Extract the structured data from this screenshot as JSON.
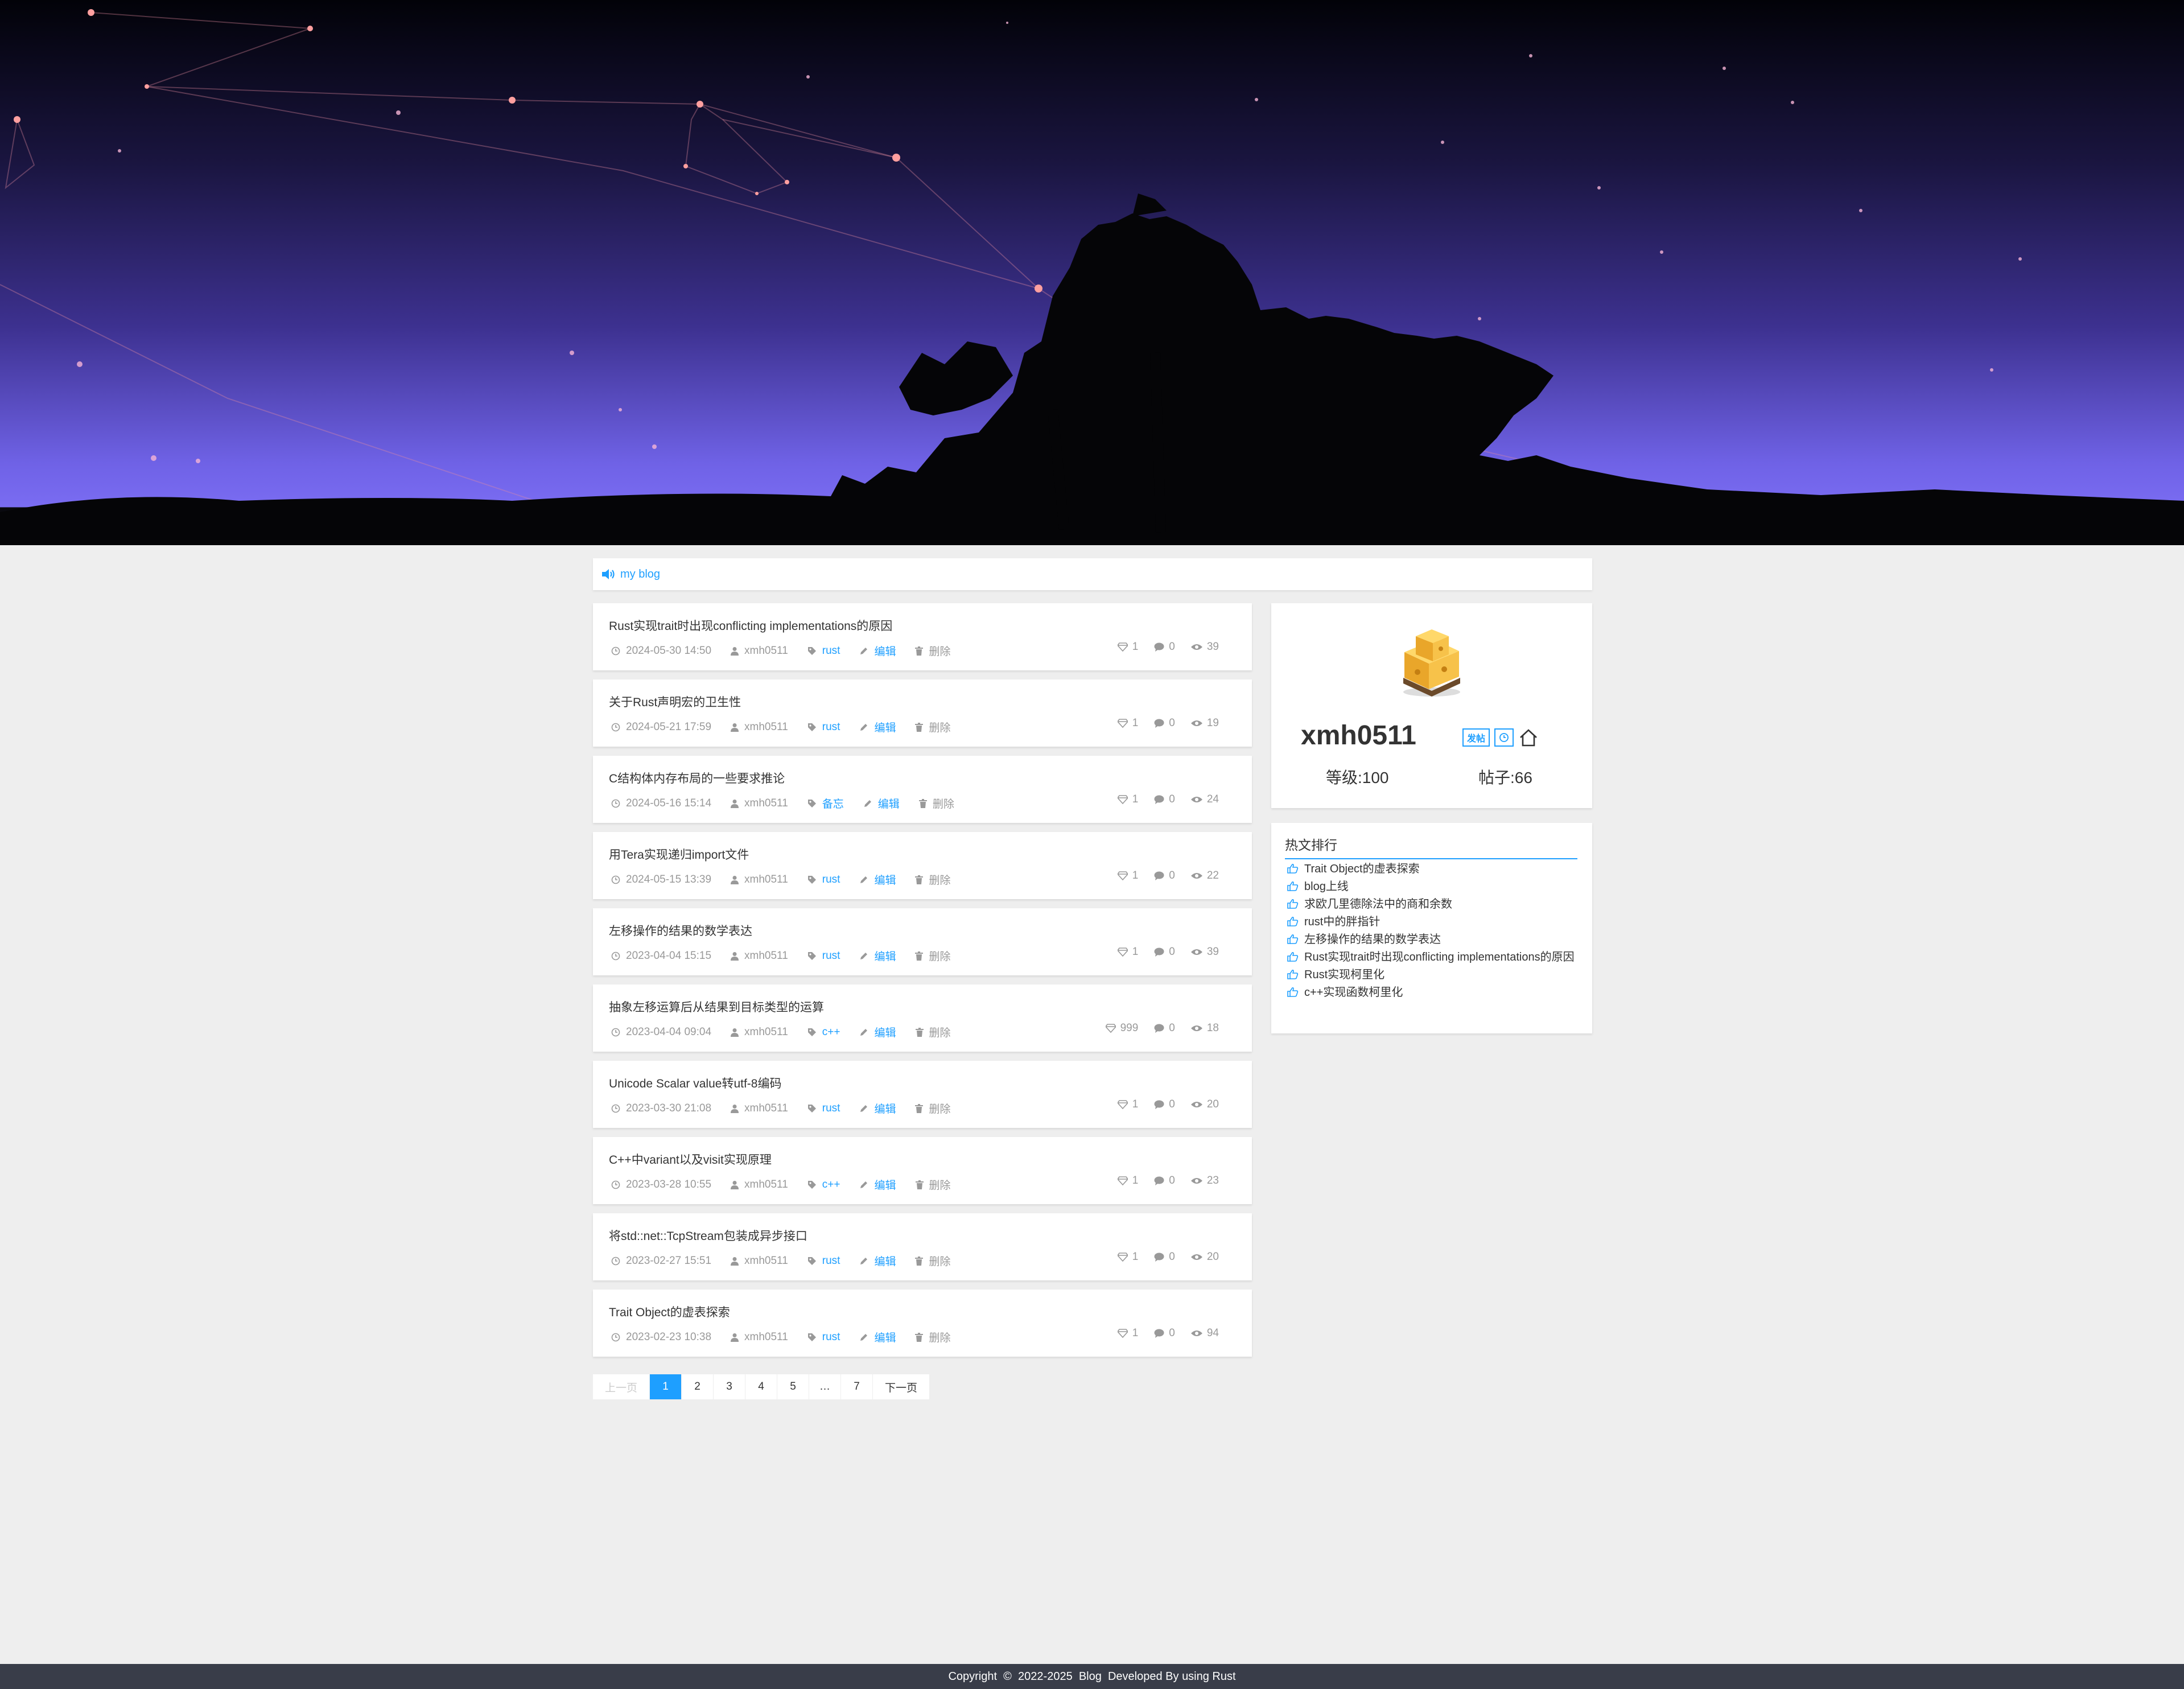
{
  "notice": {
    "label": "my blog"
  },
  "posts": [
    {
      "title": "Rust实现trait时出现conflicting implementations的原因",
      "date": "2024-05-30 14:50",
      "author": "xmh0511",
      "tag": "rust",
      "edit": "编辑",
      "delete": "删除",
      "likes": "1",
      "comments": "0",
      "views": "39"
    },
    {
      "title": "关于Rust声明宏的卫生性",
      "date": "2024-05-21 17:59",
      "author": "xmh0511",
      "tag": "rust",
      "edit": "编辑",
      "delete": "删除",
      "likes": "1",
      "comments": "0",
      "views": "19"
    },
    {
      "title": "C结构体内存布局的一些要求推论",
      "date": "2024-05-16 15:14",
      "author": "xmh0511",
      "tag": "备忘",
      "edit": "编辑",
      "delete": "删除",
      "likes": "1",
      "comments": "0",
      "views": "24"
    },
    {
      "title": "用Tera实现递归import文件",
      "date": "2024-05-15 13:39",
      "author": "xmh0511",
      "tag": "rust",
      "edit": "编辑",
      "delete": "删除",
      "likes": "1",
      "comments": "0",
      "views": "22"
    },
    {
      "title": "左移操作的结果的数学表达",
      "date": "2023-04-04 15:15",
      "author": "xmh0511",
      "tag": "rust",
      "edit": "编辑",
      "delete": "删除",
      "likes": "1",
      "comments": "0",
      "views": "39"
    },
    {
      "title": "抽象左移运算后从结果到目标类型的运算",
      "date": "2023-04-04 09:04",
      "author": "xmh0511",
      "tag": "c++",
      "edit": "编辑",
      "delete": "删除",
      "likes": "999",
      "comments": "0",
      "views": "18"
    },
    {
      "title": "Unicode Scalar value转utf-8编码",
      "date": "2023-03-30 21:08",
      "author": "xmh0511",
      "tag": "rust",
      "edit": "编辑",
      "delete": "删除",
      "likes": "1",
      "comments": "0",
      "views": "20"
    },
    {
      "title": "C++中variant以及visit实现原理",
      "date": "2023-03-28 10:55",
      "author": "xmh0511",
      "tag": "c++",
      "edit": "编辑",
      "delete": "删除",
      "likes": "1",
      "comments": "0",
      "views": "23"
    },
    {
      "title": "将std::net::TcpStream包装成异步接口",
      "date": "2023-02-27 15:51",
      "author": "xmh0511",
      "tag": "rust",
      "edit": "编辑",
      "delete": "删除",
      "likes": "1",
      "comments": "0",
      "views": "20"
    },
    {
      "title": "Trait Object的虚表探索",
      "date": "2023-02-23 10:38",
      "author": "xmh0511",
      "tag": "rust",
      "edit": "编辑",
      "delete": "删除",
      "likes": "1",
      "comments": "0",
      "views": "94"
    }
  ],
  "pager": {
    "prev": "上一页",
    "pages": [
      "1",
      "2",
      "3",
      "4",
      "5",
      "…",
      "7"
    ],
    "current": "1",
    "next": "下一页"
  },
  "profile": {
    "username": "xmh0511",
    "badge_post": "发帖",
    "level": "等级:100",
    "post_count": "帖子:66"
  },
  "hot": {
    "title": "热文排行",
    "items": [
      "Trait Object的虚表探索",
      "blog上线",
      "求欧几里德除法中的商和余数",
      "rust中的胖指针",
      "左移操作的结果的数学表达",
      "Rust实现trait时出现conflicting implementations的原因",
      "Rust实现柯里化",
      "c++实现函数柯里化"
    ]
  },
  "footer": {
    "copyright": "Copyright",
    "symbol": "©",
    "years": "2022-2025",
    "brand": "Blog",
    "developed": "Developed By using Rust"
  },
  "colors": {
    "accent": "#1e9fff",
    "footer_bg": "#393d49",
    "page_bg": "#eeeeee",
    "banner_sky": "#6f62e6"
  }
}
